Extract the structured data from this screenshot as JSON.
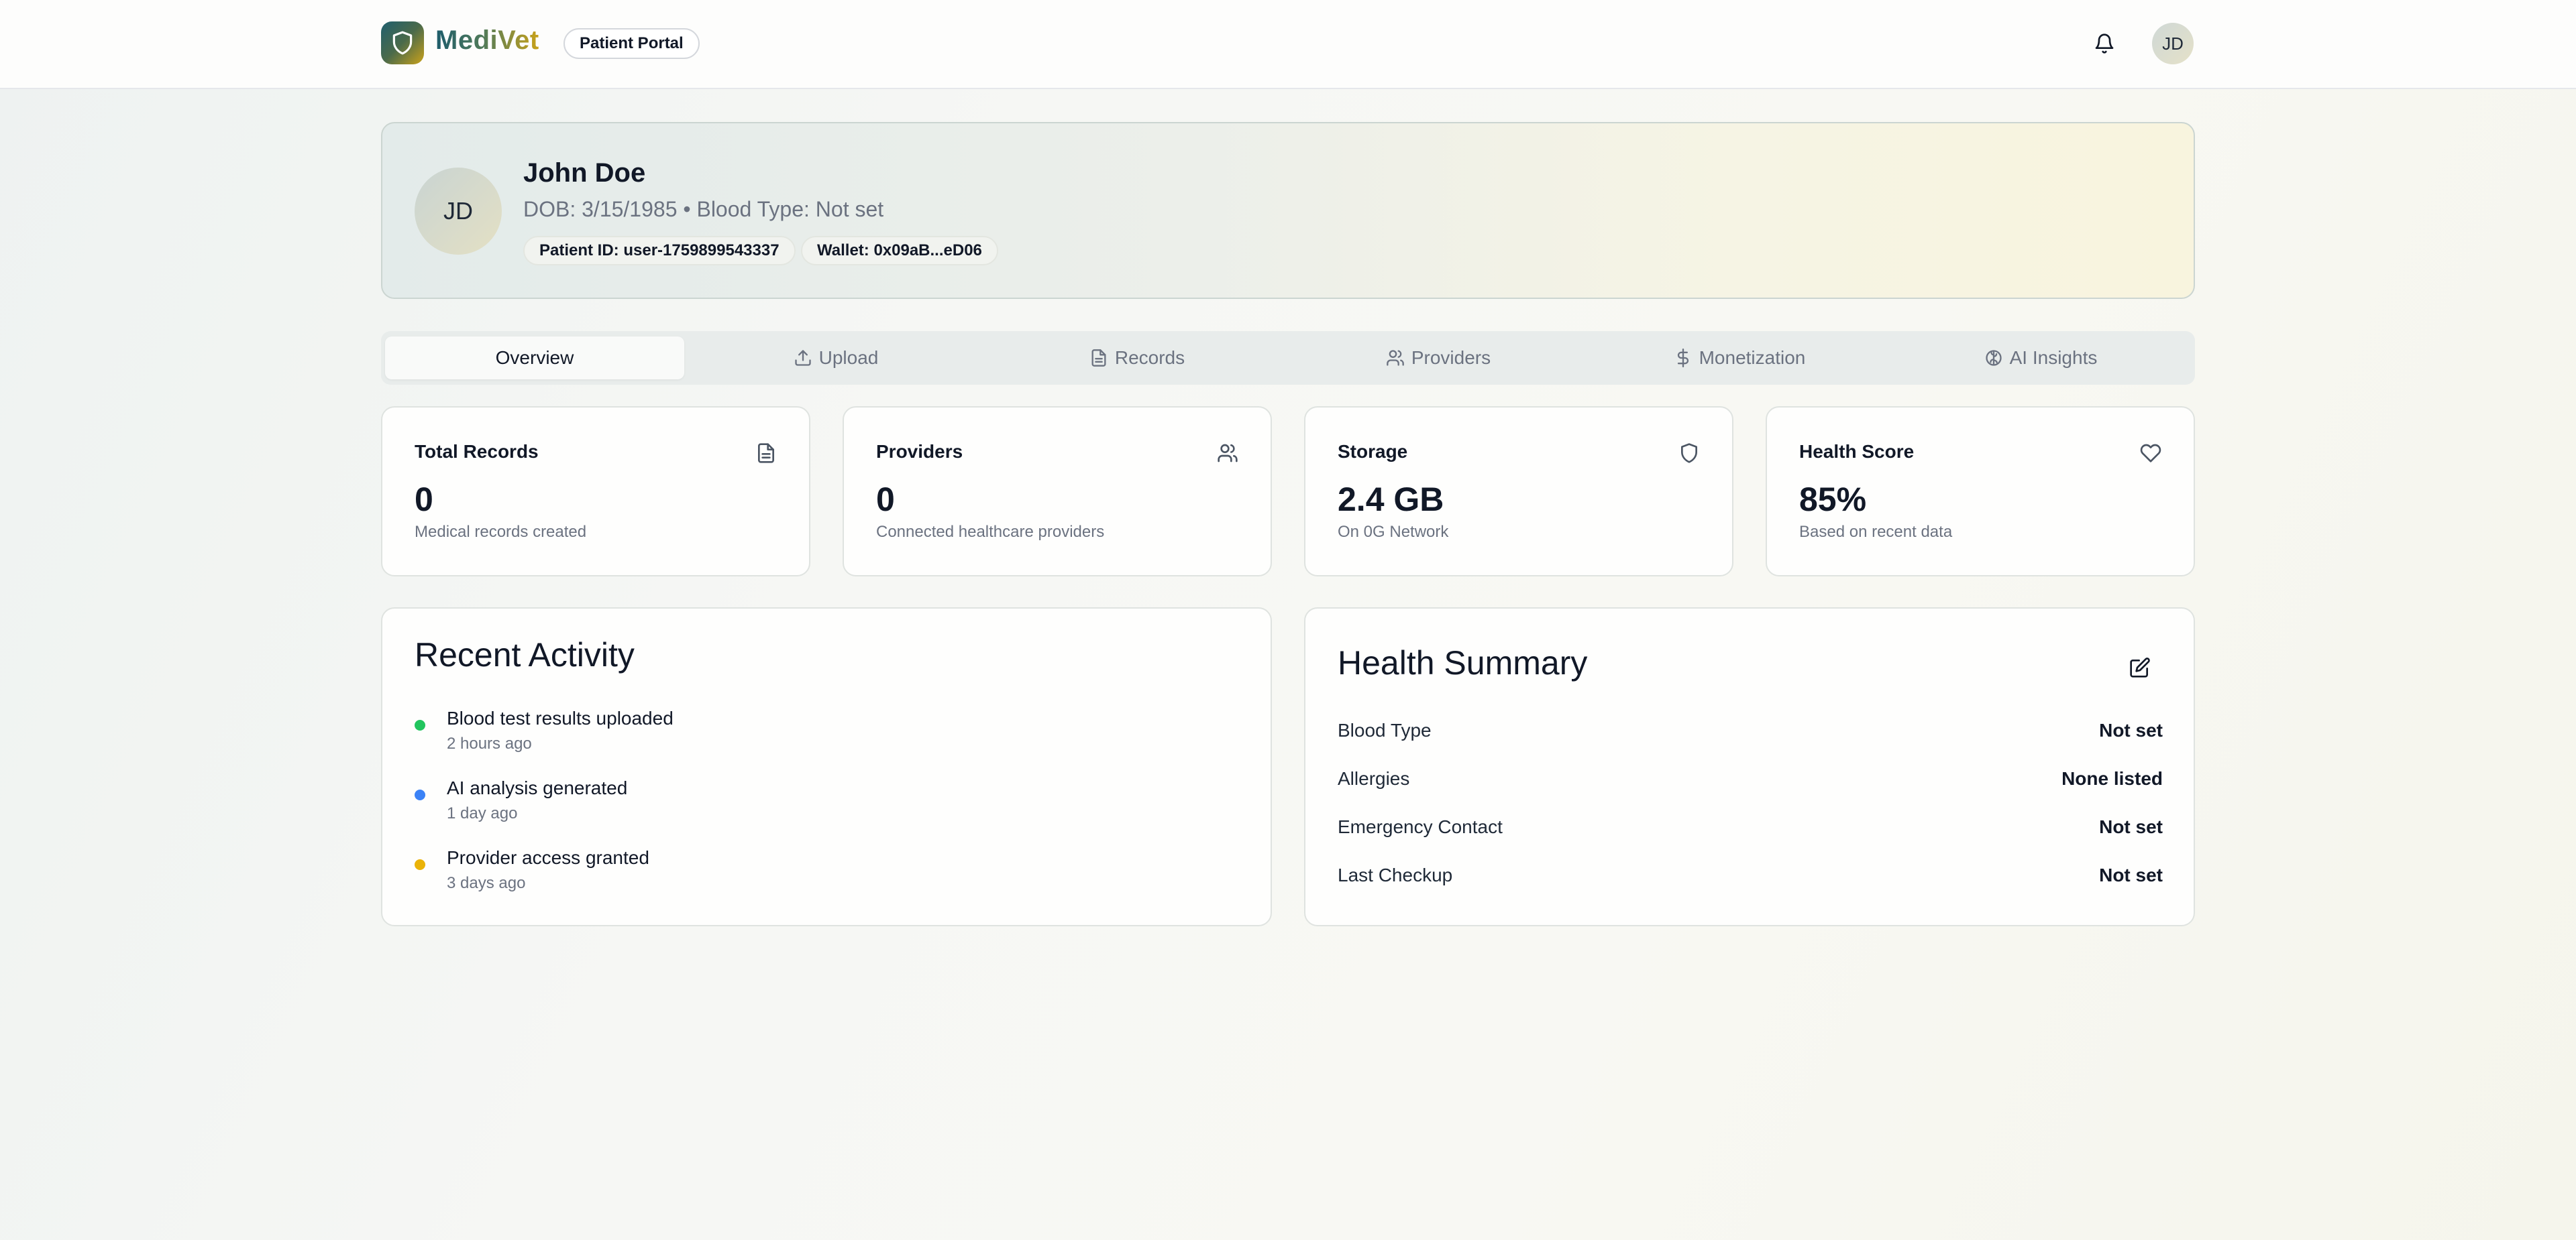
{
  "header": {
    "brand": "MediVet",
    "portal_label": "Patient Portal",
    "user_initials": "JD",
    "icons": [
      "shield-icon",
      "bell-icon"
    ]
  },
  "profile": {
    "initials": "JD",
    "name": "John Doe",
    "meta": "DOB: 3/15/1985 • Blood Type: Not set",
    "patient_id": "Patient ID: user-1759899543337",
    "wallet": "Wallet: 0x09aB...eD06"
  },
  "tabs": [
    {
      "label": "Overview",
      "icon": "",
      "active": true
    },
    {
      "label": "Upload",
      "icon": "upload-icon",
      "active": false
    },
    {
      "label": "Records",
      "icon": "file-icon",
      "active": false
    },
    {
      "label": "Providers",
      "icon": "users-icon",
      "active": false
    },
    {
      "label": "Monetization",
      "icon": "dollar-icon",
      "active": false
    },
    {
      "label": "AI Insights",
      "icon": "brain-icon",
      "active": false
    }
  ],
  "stats": [
    {
      "title": "Total Records",
      "value": "0",
      "sub": "Medical records created",
      "icon": "file-icon"
    },
    {
      "title": "Providers",
      "value": "0",
      "sub": "Connected healthcare providers",
      "icon": "users-icon"
    },
    {
      "title": "Storage",
      "value": "2.4 GB",
      "sub": "On 0G Network",
      "icon": "shield-icon"
    },
    {
      "title": "Health Score",
      "value": "85%",
      "sub": "Based on recent data",
      "icon": "heart-icon"
    }
  ],
  "activity": {
    "title": "Recent Activity",
    "items": [
      {
        "title": "Blood test results uploaded",
        "time": "2 hours ago",
        "color": "#22c55e"
      },
      {
        "title": "AI analysis generated",
        "time": "1 day ago",
        "color": "#3b82f6"
      },
      {
        "title": "Provider access granted",
        "time": "3 days ago",
        "color": "#eab308"
      }
    ]
  },
  "health_summary": {
    "title": "Health Summary",
    "edit_icon": "edit-icon",
    "rows": [
      {
        "label": "Blood Type",
        "value": "Not set"
      },
      {
        "label": "Allergies",
        "value": "None listed"
      },
      {
        "label": "Emergency Contact",
        "value": "Not set"
      },
      {
        "label": "Last Checkup",
        "value": "Not set"
      }
    ]
  },
  "colors": {
    "brand_teal": "#1e5c6b",
    "brand_gold": "#c9a21a",
    "muted_text": "#6b7280"
  }
}
